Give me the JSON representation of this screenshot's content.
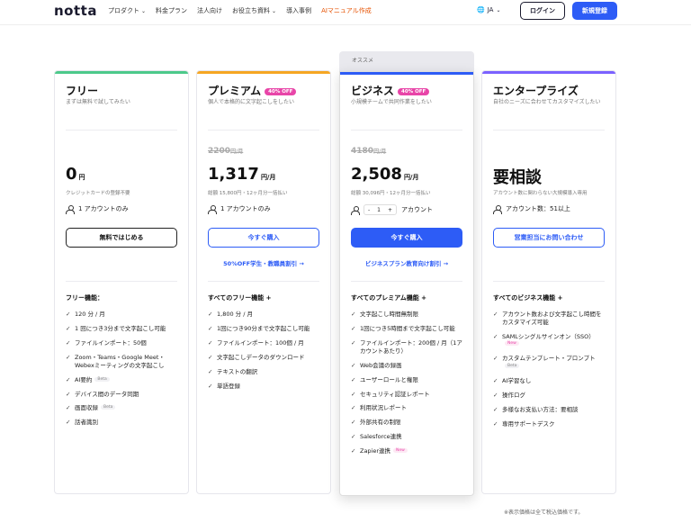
{
  "header": {
    "logo": "notta",
    "nav": [
      {
        "label": "プロダクト",
        "chevron": true,
        "highlight": false
      },
      {
        "label": "料金プラン",
        "chevron": false,
        "highlight": false
      },
      {
        "label": "法人向け",
        "chevron": false,
        "highlight": false
      },
      {
        "label": "お役立ち資料",
        "chevron": true,
        "highlight": false
      },
      {
        "label": "導入事例",
        "chevron": false,
        "highlight": false
      },
      {
        "label": "AIマニュアル作成",
        "chevron": false,
        "highlight": true
      }
    ],
    "lang": "JA",
    "login_label": "ログイン",
    "register_label": "新規登録"
  },
  "recommended_label": "オススメ",
  "plans": [
    {
      "name": "フリー",
      "badge": "",
      "accent": "#4cc98a",
      "desc": "まずは無料で試してみたい",
      "old_price": "",
      "price": "0",
      "unit": "円",
      "price_note": "クレジットカードの登録不要",
      "seat": "1 アカウントのみ",
      "cta": "無料ではじめる",
      "cta_style": "outline-dark",
      "link": "",
      "features_title": "フリー機能：",
      "features": [
        {
          "text": "120 分 / 月",
          "tag": ""
        },
        {
          "text": "1 回につき3分まで文字起こし可能",
          "tag": ""
        },
        {
          "text": "ファイルインポート：50個",
          "tag": ""
        },
        {
          "text": "Zoom・Teams・Google Meet・Webexミーティングの文字起こし",
          "tag": ""
        },
        {
          "text": "AI要約",
          "tag": "Beta"
        },
        {
          "text": "デバイス間のデータ同期",
          "tag": ""
        },
        {
          "text": "画面収録",
          "tag": "Beta"
        },
        {
          "text": "話者識別",
          "tag": ""
        }
      ]
    },
    {
      "name": "プレミアム",
      "badge": "40% OFF",
      "accent": "#f5a623",
      "desc": "個人で本格的に文字起こしをしたい",
      "old_price": "2200",
      "old_unit": "円/月",
      "price": "1,317",
      "unit": "円/月",
      "price_note": "総額 15,800円・12ヶ月分一括払い",
      "seat": "1 アカウントのみ",
      "cta": "今すぐ購入",
      "cta_style": "outline-blue",
      "link": "50%OFF学生・教職員割引 →",
      "features_title": "すべてのフリー機能 +",
      "features": [
        {
          "text": "1,800 分 / 月",
          "tag": ""
        },
        {
          "text": "1回につき90分まで文字起こし可能",
          "tag": ""
        },
        {
          "text": "ファイルインポート：100個 / 月",
          "tag": ""
        },
        {
          "text": "文字起こしデータのダウンロード",
          "tag": ""
        },
        {
          "text": "テキストの翻訳",
          "tag": ""
        },
        {
          "text": "単語登録",
          "tag": ""
        }
      ]
    },
    {
      "name": "ビジネス",
      "badge": "40% OFF",
      "accent": "#2d5cf6",
      "desc": "小規模チームで共同作業をしたい",
      "old_price": "4180",
      "old_unit": "円/月",
      "price": "2,508",
      "unit": "円/月",
      "price_note": "総額 30,096円・12ヶ月分一括払い",
      "seat_stepper": {
        "minus": "-",
        "value": "1",
        "plus": "+"
      },
      "seat": "アカウント",
      "cta": "今すぐ購入",
      "cta_style": "solid",
      "link": "ビジネスプラン教育向け割引 →",
      "features_title": "すべてのプレミアム機能 +",
      "features": [
        {
          "text": "文字起こし時間無制限",
          "tag": ""
        },
        {
          "text": "1回につき5時間まで文字起こし可能",
          "tag": ""
        },
        {
          "text": "ファイルインポート：200個 / 月（1アカウントあたり）",
          "tag": ""
        },
        {
          "text": "Web会議の録画",
          "tag": ""
        },
        {
          "text": "ユーザーロールと権限",
          "tag": ""
        },
        {
          "text": "セキュリティ認証レポート",
          "tag": ""
        },
        {
          "text": "利用状況レポート",
          "tag": ""
        },
        {
          "text": "外部共有の制限",
          "tag": ""
        },
        {
          "text": "Salesforce連携",
          "tag": ""
        },
        {
          "text": "Zapier連携",
          "tag": "New"
        }
      ]
    },
    {
      "name": "エンタープライズ",
      "badge": "",
      "accent": "#7b61ff",
      "desc": "自社のニーズに合わせてカスタマイズしたい",
      "old_price": "",
      "price": "要相談",
      "unit": "",
      "price_note": "アカウント数に関わらない大規模導入専用",
      "seat": "アカウント数：51以上",
      "cta": "営業担当にお問い合わせ",
      "cta_style": "outline-blue",
      "link": "",
      "features_title": "すべてのビジネス機能 +",
      "features": [
        {
          "text": "アカウント数および文字起こし時間をカスタマイズ可能",
          "tag": ""
        },
        {
          "text": "SAMLシングルサインオン（SSO）",
          "tag": "New"
        },
        {
          "text": "カスタムテンプレート・プロンプト",
          "tag": "Beta"
        },
        {
          "text": "AI学習なし",
          "tag": ""
        },
        {
          "text": "操作ログ",
          "tag": ""
        },
        {
          "text": "多様なお支払い方法：要相談",
          "tag": ""
        },
        {
          "text": "専用サポートデスク",
          "tag": ""
        }
      ]
    }
  ],
  "footnote": "※表示価格は全て税込価格です。"
}
